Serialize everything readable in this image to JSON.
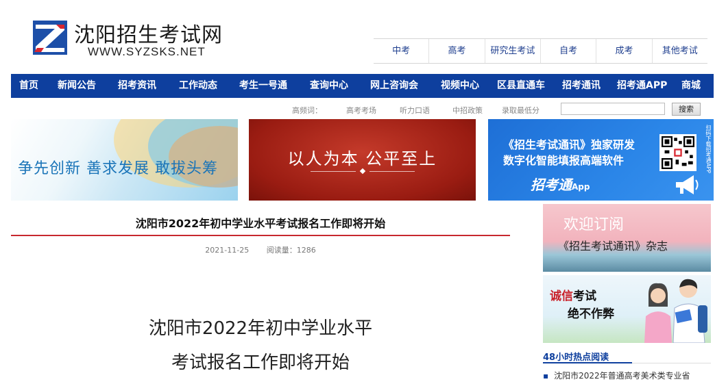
{
  "site": {
    "title": "沈阳招生考试网",
    "domain": "WWW.SYZSKS.NET"
  },
  "top_links": [
    "中考",
    "高考",
    "研究生考试",
    "自考",
    "成考",
    "其他考试"
  ],
  "nav": [
    "首页",
    "新闻公告",
    "招考资讯",
    "工作动态",
    "考生一号通",
    "查询中心",
    "网上咨询会",
    "视频中心",
    "区县直通车",
    "招考通讯",
    "招考通APP",
    "商城"
  ],
  "search": {
    "keywords_label": "高频词：",
    "keywords": [
      "高考考场",
      "听力口语",
      "中招政策",
      "录取最低分"
    ],
    "input_value": "",
    "button_label": "搜索"
  },
  "banners": {
    "left_text": "争先创新 善求发展 敢拔头筹",
    "middle_text": "以人为本  公平至上",
    "right_line1": "《招生考试通讯》独家研发",
    "right_line2": "数字化智能填报高端软件",
    "right_brand": "招考通",
    "right_brand_suffix": "App",
    "right_side_text": "扫码下载招考通APP"
  },
  "article": {
    "title": "沈阳市2022年初中学业水平考试报名工作即将开始",
    "date": "2021-11-25",
    "reads": "阅读量：1286",
    "body_line1": "沈阳市2022年初中学业水平",
    "body_line2": "考试报名工作即将开始"
  },
  "sidebar": {
    "ad1_line1": "欢迎订阅",
    "ad1_line2": "《招生考试通讯》杂志",
    "ad2_red": "诚信",
    "ad2_black": "考试",
    "ad2_line2": "绝不作弊",
    "hot_title": "48小时热点阅读",
    "hot_items": [
      "沈阳市2022年普通高考美术类专业省"
    ]
  },
  "colors": {
    "nav_bg": "#0e3f9e",
    "accent_red": "#c7272e",
    "link_blue": "#1f3f8f"
  }
}
